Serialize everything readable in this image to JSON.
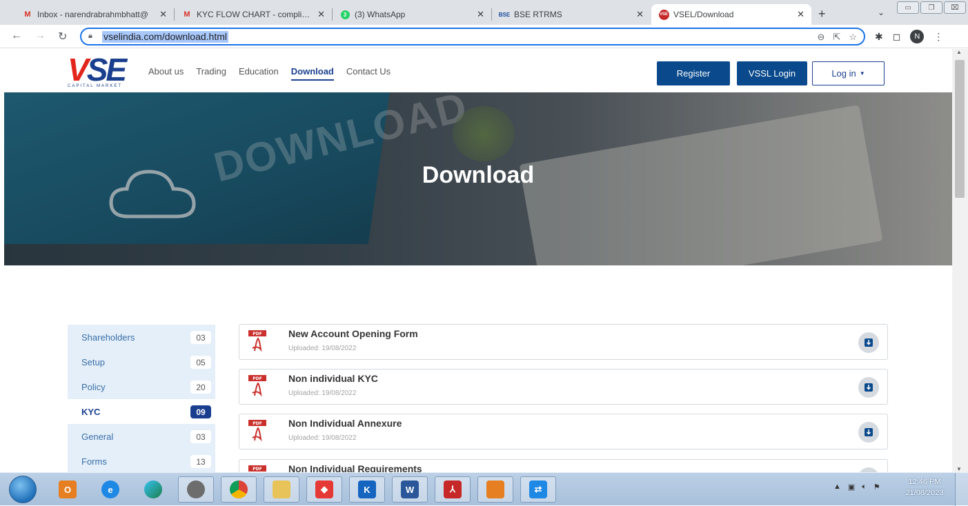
{
  "browser": {
    "tabs": [
      {
        "label": "Inbox - narendrabrahmbhatt@",
        "favicon": "gmail-icon"
      },
      {
        "label": "KYC FLOW CHART - complianc",
        "favicon": "gmail-icon"
      },
      {
        "label": "(3) WhatsApp",
        "favicon": "whatsapp-icon"
      },
      {
        "label": "BSE RTRMS",
        "favicon": "bse-icon"
      },
      {
        "label": "VSEL/Download",
        "favicon": "vse-icon"
      }
    ],
    "bse_fav": "BSE",
    "vse_fav": "VSE",
    "url": "vselindia.com/download.html",
    "profile_initial": "N"
  },
  "site": {
    "logo_text": "VSE",
    "logo_subtext": "CAPITAL MARKET",
    "nav": [
      "About us",
      "Trading",
      "Education",
      "Download",
      "Contact Us"
    ],
    "active_nav": "Download",
    "buttons": {
      "register": "Register",
      "vssl_login": "VSSL Login",
      "login": "Log in"
    },
    "hero_title": "Download",
    "hero_image_text": "DOWNLOAD"
  },
  "categories": [
    {
      "name": "Shareholders",
      "count": "03"
    },
    {
      "name": "Setup",
      "count": "05"
    },
    {
      "name": "Policy",
      "count": "20"
    },
    {
      "name": "KYC",
      "count": "09",
      "active": true
    },
    {
      "name": "General",
      "count": "03"
    },
    {
      "name": "Forms",
      "count": "13"
    }
  ],
  "documents": [
    {
      "title": "New Account Opening Form",
      "uploaded": "Uploaded: 19/08/2022"
    },
    {
      "title": "Non individual KYC",
      "uploaded": "Uploaded: 19/08/2022"
    },
    {
      "title": "Non Individual Annexure",
      "uploaded": "Uploaded: 19/08/2022"
    },
    {
      "title": "Non Individual Requirements",
      "uploaded": ""
    }
  ],
  "pdf_badge": "PDF",
  "taskbar": {
    "time": "12:46 PM",
    "date": "21/08/2023"
  },
  "colors": {
    "brand": "#1b3f8f",
    "button": "#0a4a8c",
    "accent_red": "#e2261c"
  }
}
